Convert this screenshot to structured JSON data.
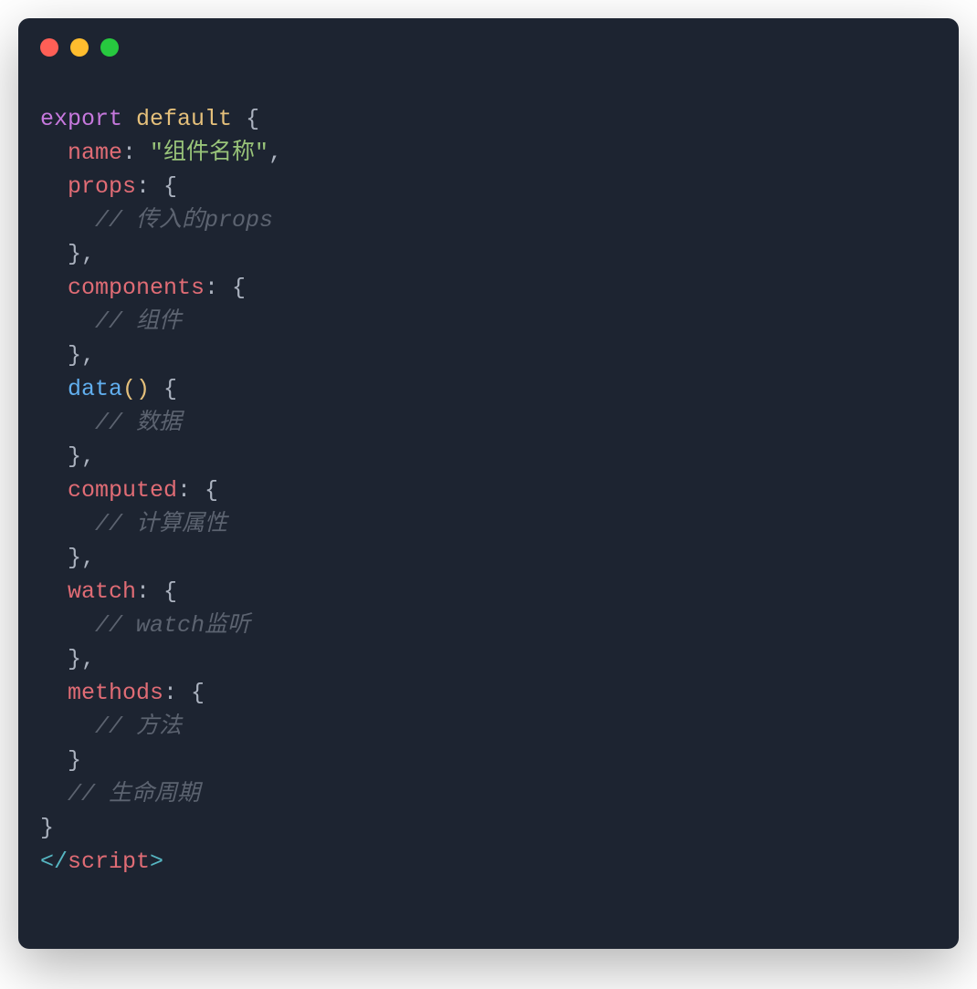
{
  "code": {
    "line1": {
      "export": "export",
      "default": "default",
      "brace": " {"
    },
    "line2": {
      "indent": "  ",
      "prop": "name",
      "colon": ": ",
      "value": "\"组件名称\"",
      "comma": ","
    },
    "line3": {
      "indent": "  ",
      "prop": "props",
      "rest": ": {"
    },
    "line4": {
      "indent": "    ",
      "comment": "// 传入的props"
    },
    "line5": {
      "indent": "  ",
      "close": "},"
    },
    "line6": {
      "indent": "  ",
      "prop": "components",
      "rest": ": {"
    },
    "line7": {
      "indent": "    ",
      "comment": "// 组件"
    },
    "line8": {
      "indent": "  ",
      "close": "},"
    },
    "line9": {
      "indent": "  ",
      "method": "data",
      "parens": "()",
      "rest": " {"
    },
    "line10": {
      "indent": "    ",
      "comment": "// 数据"
    },
    "line11": {
      "indent": "  ",
      "close": "},"
    },
    "line12": {
      "indent": "  ",
      "prop": "computed",
      "rest": ": {"
    },
    "line13": {
      "indent": "    ",
      "comment": "// 计算属性"
    },
    "line14": {
      "indent": "  ",
      "close": "},"
    },
    "line15": {
      "indent": "  ",
      "prop": "watch",
      "rest": ": {"
    },
    "line16": {
      "indent": "    ",
      "comment": "// watch监听"
    },
    "line17": {
      "indent": "  ",
      "close": "},"
    },
    "line18": {
      "indent": "  ",
      "prop": "methods",
      "rest": ": {"
    },
    "line19": {
      "indent": "    ",
      "comment": "// 方法"
    },
    "line20": {
      "indent": "  ",
      "close": "}"
    },
    "line21": {
      "indent": "  ",
      "comment": "// 生命周期"
    },
    "line22": {
      "close": "}"
    },
    "line23": {
      "lt": "<",
      "slash": "/",
      "tag": "script",
      "gt": ">"
    }
  }
}
